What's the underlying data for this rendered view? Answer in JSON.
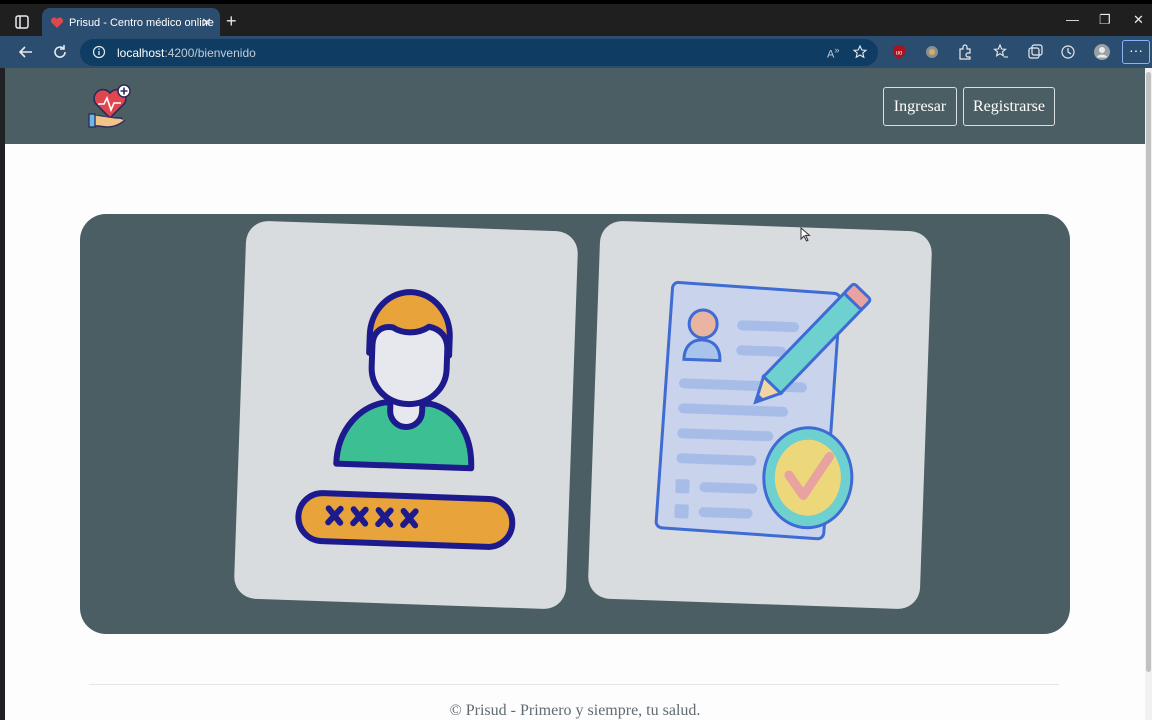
{
  "browser": {
    "tab_title": "Prisud - Centro médico online",
    "url_host": "localhost",
    "url_path": ":4200/bienvenido"
  },
  "header": {
    "login_label": "Ingresar",
    "register_label": "Registrarse"
  },
  "footer": {
    "text": "© Prisud - Primero y siempre, tu salud."
  }
}
